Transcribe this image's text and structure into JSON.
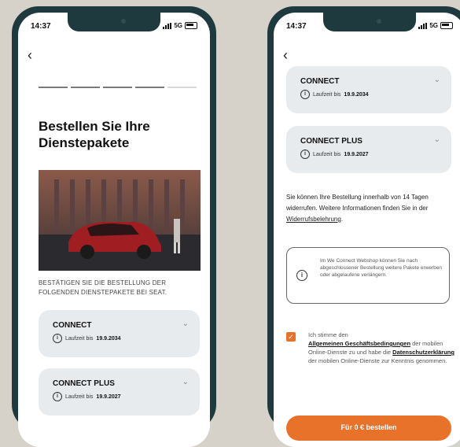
{
  "status_bar": {
    "time": "14:37",
    "network": "5G"
  },
  "left_screen": {
    "title": "Bestellen Sie Ihre Dienstepakete",
    "instruction": "BESTÄTIGEN SIE DIE BESTELLUNG DER FOLGENDEN DIENSTEPAKETE BEI SEAT.",
    "progress_steps": 5,
    "packages": [
      {
        "name": "CONNECT",
        "runtime_label": "Laufzeit bis",
        "runtime_date": "19.9.2034"
      },
      {
        "name": "CONNECT PLUS",
        "runtime_label": "Laufzeit bis",
        "runtime_date": "19.9.2027"
      }
    ]
  },
  "right_screen": {
    "packages": [
      {
        "name": "CONNECT",
        "runtime_label": "Laufzeit bis",
        "runtime_date": "19.9.2034"
      },
      {
        "name": "CONNECT PLUS",
        "runtime_label": "Laufzeit bis",
        "runtime_date": "19.9.2027"
      }
    ],
    "withdrawal_text": "Sie können Ihre Bestellung innerhalb von 14 Tagen widerrufen. Weitere Informationen finden Sie in der",
    "withdrawal_link": "Widerrufsbelehrung",
    "webshop_info": "Im We Connect Webshop können Sie nach abgeschlossener Bestellung weitere Pakete erwerben oder abgelaufene verlängern.",
    "consent": {
      "prefix": "Ich stimme den",
      "terms_link": "Allgemeinen Geschäftsbedingungen",
      "middle": "der mobilen Online-Dienste zu und habe die",
      "privacy_link": "Datenschutzerklärung",
      "suffix": "der mobilen Online-Dienste zur Kenntnis genommen.",
      "checked": true
    },
    "cta_label": "Für 0 € bestellen"
  },
  "colors": {
    "accent": "#e8722a",
    "phone_frame": "#1e3a3e",
    "card_bg": "#e7ebee",
    "background": "#d6d1c9"
  },
  "icons": [
    "back-chevron-icon",
    "info-icon",
    "chevron-down-icon",
    "checkmark-icon",
    "signal-icon",
    "battery-icon"
  ]
}
